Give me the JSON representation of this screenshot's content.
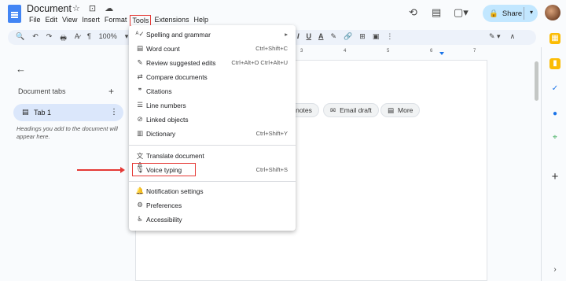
{
  "app": {
    "title": "Document",
    "title_icons": "☆ ⊡ ☁",
    "menubar": [
      "File",
      "Edit",
      "View",
      "Insert",
      "Format",
      "Tools",
      "Extensions",
      "Help"
    ],
    "share_label": "Share"
  },
  "toolbar": {
    "left": [
      "🔍",
      "↶",
      "↷",
      "🖶",
      "A̷",
      "¶",
      "100%",
      "▾"
    ],
    "right": [
      "I",
      "U",
      "A",
      "✎",
      "🔗",
      "⊞",
      "▣",
      "⋮"
    ],
    "far": [
      "✎ ▾",
      "∧"
    ],
    "zoom": "100%"
  },
  "ruler": [
    "3",
    "4",
    "5",
    "6",
    "7"
  ],
  "sidebar": {
    "title": "Document tabs",
    "add": "+",
    "tab_label": "Tab 1",
    "hint": "Headings you add to the document will appear here."
  },
  "chips": [
    {
      "label": "g notes"
    },
    {
      "label": "Email draft",
      "icon": "✉"
    },
    {
      "label": "More",
      "icon": "▤"
    }
  ],
  "menu": {
    "items": [
      {
        "label": "Spelling and grammar",
        "icon": "ᴬ✓",
        "shortcut": "▸"
      },
      {
        "label": "Word count",
        "icon": "▤",
        "shortcut": "Ctrl+Shift+C"
      },
      {
        "label": "Review suggested edits",
        "icon": "✎",
        "shortcut": "Ctrl+Alt+O Ctrl+Alt+U"
      },
      {
        "label": "Compare documents",
        "icon": "⇄",
        "shortcut": ""
      },
      {
        "label": "Citations",
        "icon": "❞",
        "shortcut": ""
      },
      {
        "label": "Line numbers",
        "icon": "☰",
        "shortcut": ""
      },
      {
        "label": "Linked objects",
        "icon": "⊘",
        "shortcut": ""
      },
      {
        "label": "Dictionary",
        "icon": "▥",
        "shortcut": "Ctrl+Shift+Y"
      },
      {
        "label": "Translate document",
        "icon": "文A",
        "shortcut": ""
      },
      {
        "label": "Voice typing",
        "icon": "🎙",
        "shortcut": "Ctrl+Shift+S"
      },
      {
        "label": "Notification settings",
        "icon": "🔔",
        "shortcut": ""
      },
      {
        "label": "Preferences",
        "icon": "⚙",
        "shortcut": ""
      },
      {
        "label": "Accessibility",
        "icon": "♿",
        "shortcut": ""
      }
    ]
  },
  "colors": {
    "accent": "#e53935",
    "share_bg": "#c2e7ff",
    "tab_bg": "#dbe7fb"
  }
}
